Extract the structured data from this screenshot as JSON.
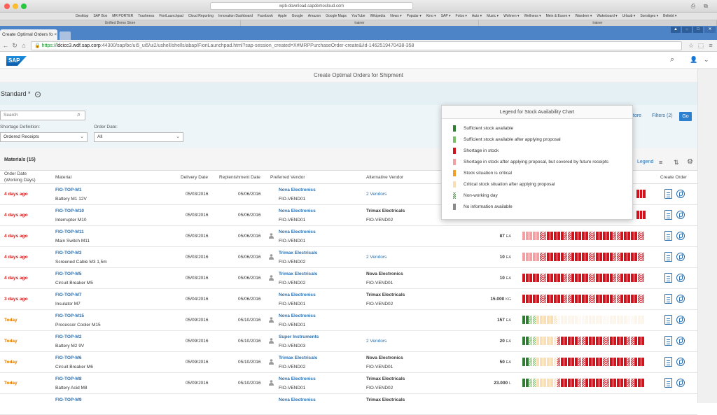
{
  "browser": {
    "os_url": "wpb-download.sapdemocloud.com",
    "bookmarks": [
      "Desktop",
      "SAP Box",
      "MR PORTER",
      "Trashness",
      "FioriLaunchpad",
      "Cloud Reporting",
      "Innovation Dashboard",
      "Facebook",
      "Apple",
      "Google",
      "Amazon",
      "Google Maps",
      "YouTube",
      "Wikipedia",
      "News ▾",
      "Popular ▾",
      "Kino ▾",
      "SAP ▾",
      "Fotos ▾",
      "Auto ▾",
      "Music ▾",
      "Wohnen ▾",
      "Wellness ▾",
      "Mein & Essen ▾",
      "Wandern ▾",
      "Wakeboard ▾",
      "Urlaub ▾",
      "Sonstiges ▾",
      "Beliebt ▾"
    ],
    "top_tabs": [
      "Unified Demo Store",
      "trainer",
      "trainer"
    ],
    "tab_title": "Create Optimal Orders fo ×",
    "window_user": "▲",
    "address_scheme": "https://",
    "address_host": "ldcicc3.wdf.sap.corp",
    "address_path": ":44300/sap/bc/ui5_ui5/ui2/ushell/shells/abap/FioriLaunchpad.html?sap-session_created=X#MRPPurchaseOrder-create&/id-1462519470438-358"
  },
  "shell": {
    "logo_text": "SAP"
  },
  "page": {
    "title": "Create Optimal Orders for Shipment"
  },
  "variant": {
    "name": "Standard *"
  },
  "filter": {
    "search_placeholder": "Search",
    "shortage_label": "Shortage Definition:",
    "shortage_value": "Ordered Receipts",
    "order_date_label": "Order Date:",
    "order_date_value": "All",
    "store_link": "tore",
    "filters_link": "Filters (2)",
    "go": "Go"
  },
  "table": {
    "title": "Materials (15)",
    "legend_link": "Legend",
    "headers": {
      "order_date": "Order Date",
      "order_date_sub": "(Working Days)",
      "material": "Material",
      "delivery": "Delivery Date",
      "replenishment": "Replenishment Date",
      "preferred": "Preferred Vendor",
      "alternative": "Alternative Vendor",
      "create_order": "Create Order"
    },
    "rows": [
      {
        "due": "4 days ago",
        "due_color": "red",
        "id": "FIO-TOP-M1",
        "name": "Battery M1 12V",
        "delivery": "05/03/2016",
        "repl": "05/06/2016",
        "pv": "Nova Electronics",
        "pv_id": "FIO-VEND01",
        "av_link": "2 Vendors",
        "av_name": "",
        "av_id": "",
        "qty": "",
        "unit": "",
        "person": false,
        "bars": "r"
      },
      {
        "due": "4 days ago",
        "due_color": "red",
        "id": "FIO-TOP-M10",
        "name": "Interrupter M10",
        "delivery": "05/03/2016",
        "repl": "05/06/2016",
        "pv": "Nova Electronics",
        "pv_id": "FIO-VEND01",
        "av_link": "",
        "av_name": "Trimax Electricals",
        "av_id": "FIO-VEND02",
        "qty": "",
        "unit": "",
        "person": false,
        "bars": "r"
      },
      {
        "due": "4 days ago",
        "due_color": "red",
        "id": "FIO-TOP-M11",
        "name": "Main Switch M11",
        "delivery": "05/03/2016",
        "repl": "05/06/2016",
        "pv": "Nova Electronics",
        "pv_id": "FIO-VEND01",
        "av_link": "",
        "av_name": "",
        "av_id": "",
        "qty": "87",
        "unit": "EA",
        "person": true,
        "bars": "pr"
      },
      {
        "due": "4 days ago",
        "due_color": "red",
        "id": "FIO-TOP-M3",
        "name": "Screened Cable M3 1,5m",
        "delivery": "05/03/2016",
        "repl": "05/06/2016",
        "pv": "Trimax Electricals",
        "pv_id": "FIO-VEND02",
        "av_link": "2 Vendors",
        "av_name": "",
        "av_id": "",
        "qty": "10",
        "unit": "EA",
        "person": true,
        "bars": "pr"
      },
      {
        "due": "4 days ago",
        "due_color": "red",
        "id": "FIO-TOP-M5",
        "name": "Circuit Breaker M5",
        "delivery": "05/03/2016",
        "repl": "05/06/2016",
        "pv": "Trimax Electricals",
        "pv_id": "FIO-VEND02",
        "av_link": "",
        "av_name": "Nova Electronics",
        "av_id": "FIO-VEND01",
        "qty": "10",
        "unit": "EA",
        "person": true,
        "bars": "r"
      },
      {
        "due": "3 days ago",
        "due_color": "red",
        "id": "FIO-TOP-M7",
        "name": "Insulator M7",
        "delivery": "05/04/2016",
        "repl": "05/06/2016",
        "pv": "Nova Electronics",
        "pv_id": "FIO-VEND01",
        "av_link": "",
        "av_name": "Trimax Electricals",
        "av_id": "FIO-VEND02",
        "qty": "15.000",
        "unit": "KG",
        "person": false,
        "bars": "r"
      },
      {
        "due": "Today",
        "due_color": "orange",
        "id": "FIO-TOP-M15",
        "name": "Processor Cooler M15",
        "delivery": "05/09/2016",
        "repl": "05/10/2016",
        "pv": "Nova Electronics",
        "pv_id": "FIO-VEND01",
        "av_link": "",
        "av_name": "",
        "av_id": "",
        "qty": "157",
        "unit": "EA",
        "person": true,
        "bars": "gw"
      },
      {
        "due": "Today",
        "due_color": "orange",
        "id": "FIO-TOP-M2",
        "name": "Battery M2 9V",
        "delivery": "05/09/2016",
        "repl": "05/10/2016",
        "pv": "Super Instruments",
        "pv_id": "FIO-VEND03",
        "av_link": "2 Vendors",
        "av_name": "",
        "av_id": "",
        "qty": "20",
        "unit": "EA",
        "person": true,
        "bars": "gr"
      },
      {
        "due": "Today",
        "due_color": "orange",
        "id": "FIO-TOP-M6",
        "name": "Circuit Breaker M6",
        "delivery": "05/09/2016",
        "repl": "05/10/2016",
        "pv": "Trimax Electricals",
        "pv_id": "FIO-VEND02",
        "av_link": "",
        "av_name": "Nova Electronics",
        "av_id": "FIO-VEND01",
        "qty": "50",
        "unit": "EA",
        "person": true,
        "bars": "gr"
      },
      {
        "due": "Today",
        "due_color": "orange",
        "id": "FIO-TOP-M8",
        "name": "Battery Acid M8",
        "delivery": "05/09/2016",
        "repl": "05/10/2016",
        "pv": "Nova Electronics",
        "pv_id": "FIO-VEND01",
        "av_link": "",
        "av_name": "Trimax Electricals",
        "av_id": "FIO-VEND02",
        "qty": "23.000",
        "unit": "L",
        "person": true,
        "bars": "gr"
      },
      {
        "due": "",
        "due_color": "orange",
        "id": "FIO-TOP-M9",
        "name": "",
        "delivery": "",
        "repl": "",
        "pv": "Nova Electronics",
        "pv_id": "",
        "av_link": "",
        "av_name": "Trimax Electricals",
        "av_id": "",
        "qty": "",
        "unit": "",
        "person": false,
        "bars": "none"
      }
    ]
  },
  "legend": {
    "title": "Legend for Stock Availability Chart",
    "items": [
      {
        "label": "Sufficient stock available",
        "color": "#2e7d32",
        "style": "solid"
      },
      {
        "label": "Sufficient stock available after applying proposal",
        "color": "#7cbf6a",
        "style": "solid"
      },
      {
        "label": "Shortage in stock",
        "color": "#d0141e",
        "style": "solid"
      },
      {
        "label": "Shortage in stock after applying proposal, but covered by future receipts",
        "color": "#f2a0a4",
        "style": "solid"
      },
      {
        "label": "Stock situation is critical",
        "color": "#f0a024",
        "style": "solid"
      },
      {
        "label": "Critical stock situation after applying proposal",
        "color": "#f8dfb8",
        "style": "solid"
      },
      {
        "label": "Non-working day",
        "color": "#4f8f4f",
        "style": "hatched"
      },
      {
        "label": "No information available",
        "color": "#8a8a8a",
        "style": "solid"
      }
    ]
  }
}
